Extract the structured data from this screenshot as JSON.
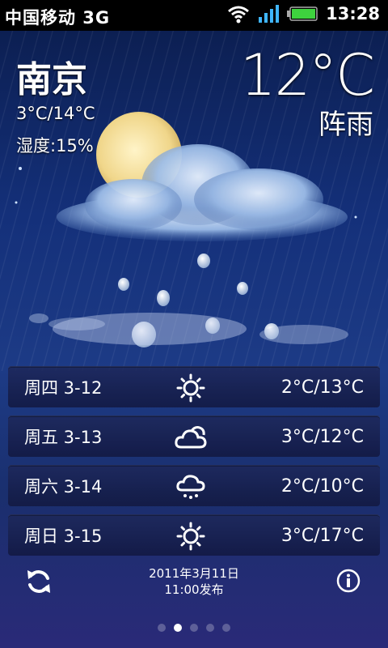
{
  "status_bar": {
    "carrier": "中国移动 3G",
    "time": "13:28",
    "icons": [
      "wifi-icon",
      "signal-icon",
      "battery-icon"
    ]
  },
  "weather": {
    "city": "南京",
    "range": "3°C/14°C",
    "humidity": "湿度:15%",
    "temperature": "12°C",
    "condition": "阵雨"
  },
  "forecast": [
    {
      "day": "周四 3-12",
      "icon": "sunny-icon",
      "temps": "2°C/13°C"
    },
    {
      "day": "周五 3-13",
      "icon": "cloudy-icon",
      "temps": "3°C/12°C"
    },
    {
      "day": "周六 3-14",
      "icon": "snow-icon",
      "temps": "2°C/10°C"
    },
    {
      "day": "周日 3-15",
      "icon": "sunny-icon",
      "temps": "3°C/17°C"
    }
  ],
  "footer": {
    "published_line1": "2011年3月11日",
    "published_line2": "11:00发布"
  },
  "pager": {
    "pages": 5,
    "active": 1
  },
  "colors": {
    "background_top": "#0c1f52",
    "background_bottom": "#2a2a78"
  }
}
